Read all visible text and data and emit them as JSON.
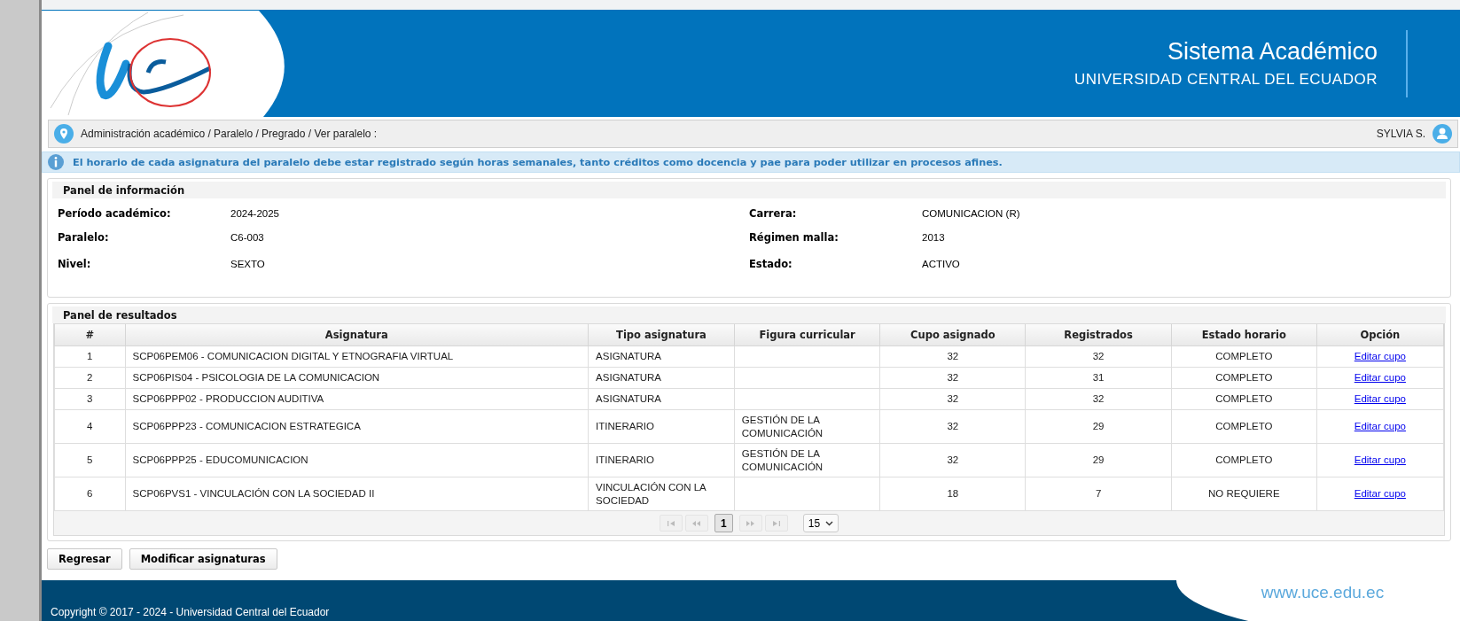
{
  "header": {
    "title": "Sistema Académico",
    "subtitle": "UNIVERSIDAD CENTRAL DEL ECUADOR"
  },
  "breadcrumb": {
    "path": "Administración académico / Paralelo / Pregrado / Ver paralelo :",
    "user": "SYLVIA S."
  },
  "notice": "El horario de cada asignatura del paralelo debe estar registrado según horas semanales, tanto créditos como docencia y pae para poder utilizar en procesos afines.",
  "info_panel": {
    "title": "Panel de información",
    "fields": [
      {
        "label": "Período académico:",
        "value": "2024-2025"
      },
      {
        "label": "Carrera:",
        "value": "COMUNICACION (R)"
      },
      {
        "label": "Paralelo:",
        "value": "C6-003"
      },
      {
        "label": "Régimen malla:",
        "value": "2013"
      },
      {
        "label": "Nivel:",
        "value": "SEXTO"
      },
      {
        "label": "Estado:",
        "value": "ACTIVO"
      }
    ]
  },
  "results_panel": {
    "title": "Panel de resultados",
    "table": {
      "columns": [
        "#",
        "Asignatura",
        "Tipo asignatura",
        "Figura curricular",
        "Cupo asignado",
        "Registrados",
        "Estado horario",
        "Opción"
      ],
      "rows": [
        [
          "1",
          "SCP06PEM06 - COMUNICACION DIGITAL Y ETNOGRAFIA VIRTUAL",
          "ASIGNATURA",
          "",
          "32",
          "32",
          "COMPLETO",
          "Editar cupo"
        ],
        [
          "2",
          "SCP06PIS04 - PSICOLOGIA DE LA COMUNICACION",
          "ASIGNATURA",
          "",
          "32",
          "31",
          "COMPLETO",
          "Editar cupo"
        ],
        [
          "3",
          "SCP06PPP02 - PRODUCCION AUDITIVA",
          "ASIGNATURA",
          "",
          "32",
          "32",
          "COMPLETO",
          "Editar cupo"
        ],
        [
          "4",
          "SCP06PPP23 - COMUNICACION ESTRATEGICA",
          "ITINERARIO",
          "GESTIÓN DE LA COMUNICACIÓN",
          "32",
          "29",
          "COMPLETO",
          "Editar cupo"
        ],
        [
          "5",
          "SCP06PPP25 - EDUCOMUNICACION",
          "ITINERARIO",
          "GESTIÓN DE LA COMUNICACIÓN",
          "32",
          "29",
          "COMPLETO",
          "Editar cupo"
        ],
        [
          "6",
          "SCP06PVS1 - VINCULACIÓN CON LA SOCIEDAD II",
          "VINCULACIÓN CON LA SOCIEDAD",
          "",
          "18",
          "7",
          "NO REQUIERE",
          "Editar cupo"
        ]
      ]
    },
    "pager": {
      "pages": [
        {
          "label": "1",
          "selected": true
        }
      ],
      "page_size": "15"
    }
  },
  "buttons": [
    "Regresar",
    "Modificar asignaturas"
  ],
  "footer": {
    "copyright": "Copyright © 2017 - 2024 - Universidad Central del Ecuador",
    "website": "www.uce.edu.ec"
  }
}
